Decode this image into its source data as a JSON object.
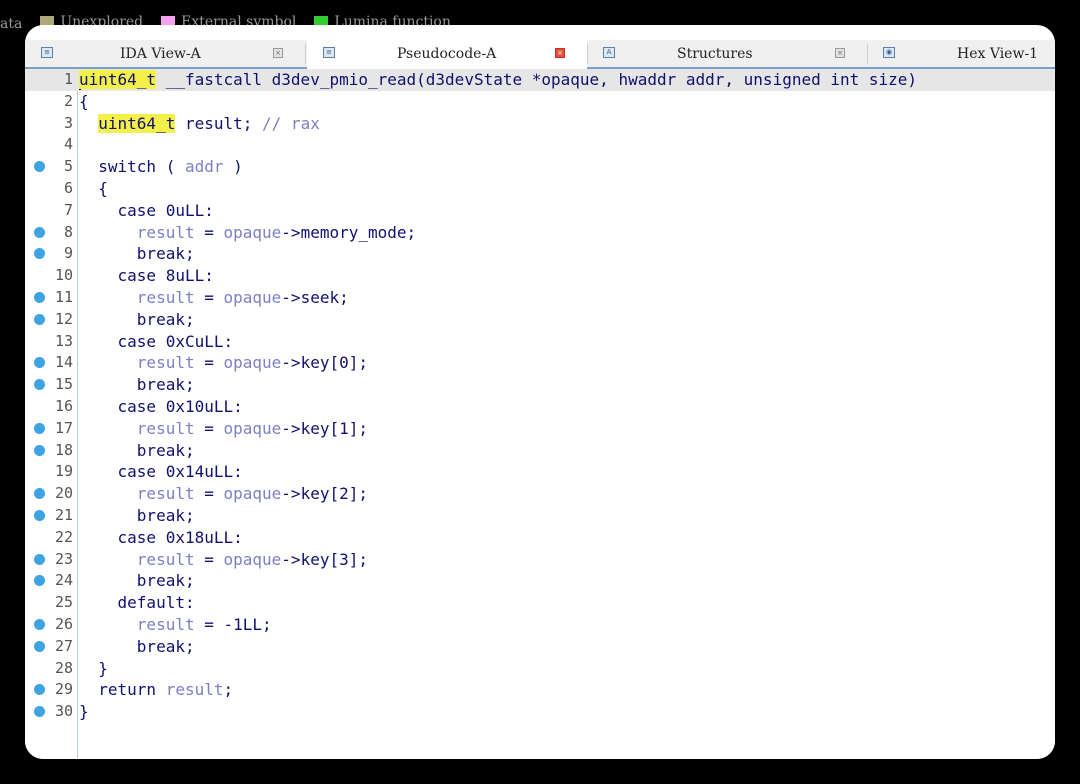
{
  "legend": [
    {
      "label": "ata",
      "color": ""
    },
    {
      "label": "Unexplored",
      "color": "#b0a878"
    },
    {
      "label": "External symbol",
      "color": "#f5a0f0"
    },
    {
      "label": "Lumina function",
      "color": "#33cc33"
    }
  ],
  "tabs": [
    {
      "label": "IDA View-A",
      "icon": "ida-view-icon",
      "active": false
    },
    {
      "label": "Pseudocode-A",
      "icon": "pseudocode-icon",
      "active": true
    },
    {
      "label": "Structures",
      "icon": "structures-icon",
      "active": false
    },
    {
      "label": "Hex View-1",
      "icon": "hex-view-icon",
      "active": false
    }
  ],
  "colors": {
    "breakpoint": "#3ea3e3",
    "highlight": "#f3f04a",
    "variable": "#7d7fc4",
    "code": "#10106e",
    "active_close": "#e74c3c"
  },
  "code_lines": [
    {
      "num": "1",
      "bp": false,
      "current": true,
      "indent": "",
      "parts": [
        [
          "uint64_t",
          "hl"
        ],
        [
          " __fastcall d3dev_pmio_read(d3devState *opaque, hwaddr addr, unsigned int size)",
          ""
        ]
      ]
    },
    {
      "num": "2",
      "bp": false,
      "indent": "",
      "parts": [
        [
          "{",
          ""
        ]
      ]
    },
    {
      "num": "3",
      "bp": false,
      "indent": "  ",
      "parts": [
        [
          "uint64_t",
          "hl"
        ],
        [
          " result; ",
          ""
        ],
        [
          "// rax",
          "var"
        ]
      ]
    },
    {
      "num": "4",
      "bp": false,
      "indent": "",
      "parts": []
    },
    {
      "num": "5",
      "bp": true,
      "indent": "  ",
      "parts": [
        [
          "switch ( ",
          ""
        ],
        [
          "addr",
          "var"
        ],
        [
          " )",
          ""
        ]
      ]
    },
    {
      "num": "6",
      "bp": false,
      "indent": "  ",
      "parts": [
        [
          "{",
          ""
        ]
      ]
    },
    {
      "num": "7",
      "bp": false,
      "indent": "    ",
      "parts": [
        [
          "case 0uLL:",
          ""
        ]
      ]
    },
    {
      "num": "8",
      "bp": true,
      "indent": "      ",
      "parts": [
        [
          "result",
          "var"
        ],
        [
          " = ",
          ""
        ],
        [
          "opaque",
          "var"
        ],
        [
          "->memory_mode;",
          ""
        ]
      ]
    },
    {
      "num": "9",
      "bp": true,
      "indent": "      ",
      "parts": [
        [
          "break;",
          ""
        ]
      ]
    },
    {
      "num": "10",
      "bp": false,
      "indent": "    ",
      "parts": [
        [
          "case 8uLL:",
          ""
        ]
      ]
    },
    {
      "num": "11",
      "bp": true,
      "indent": "      ",
      "parts": [
        [
          "result",
          "var"
        ],
        [
          " = ",
          ""
        ],
        [
          "opaque",
          "var"
        ],
        [
          "->seek;",
          ""
        ]
      ]
    },
    {
      "num": "12",
      "bp": true,
      "indent": "      ",
      "parts": [
        [
          "break;",
          ""
        ]
      ]
    },
    {
      "num": "13",
      "bp": false,
      "indent": "    ",
      "parts": [
        [
          "case 0xCuLL:",
          ""
        ]
      ]
    },
    {
      "num": "14",
      "bp": true,
      "indent": "      ",
      "parts": [
        [
          "result",
          "var"
        ],
        [
          " = ",
          ""
        ],
        [
          "opaque",
          "var"
        ],
        [
          "->key[0];",
          ""
        ]
      ]
    },
    {
      "num": "15",
      "bp": true,
      "indent": "      ",
      "parts": [
        [
          "break;",
          ""
        ]
      ]
    },
    {
      "num": "16",
      "bp": false,
      "indent": "    ",
      "parts": [
        [
          "case 0x10uLL:",
          ""
        ]
      ]
    },
    {
      "num": "17",
      "bp": true,
      "indent": "      ",
      "parts": [
        [
          "result",
          "var"
        ],
        [
          " = ",
          ""
        ],
        [
          "opaque",
          "var"
        ],
        [
          "->key[1];",
          ""
        ]
      ]
    },
    {
      "num": "18",
      "bp": true,
      "indent": "      ",
      "parts": [
        [
          "break;",
          ""
        ]
      ]
    },
    {
      "num": "19",
      "bp": false,
      "indent": "    ",
      "parts": [
        [
          "case 0x14uLL:",
          ""
        ]
      ]
    },
    {
      "num": "20",
      "bp": true,
      "indent": "      ",
      "parts": [
        [
          "result",
          "var"
        ],
        [
          " = ",
          ""
        ],
        [
          "opaque",
          "var"
        ],
        [
          "->key[2];",
          ""
        ]
      ]
    },
    {
      "num": "21",
      "bp": true,
      "indent": "      ",
      "parts": [
        [
          "break;",
          ""
        ]
      ]
    },
    {
      "num": "22",
      "bp": false,
      "indent": "    ",
      "parts": [
        [
          "case 0x18uLL:",
          ""
        ]
      ]
    },
    {
      "num": "23",
      "bp": true,
      "indent": "      ",
      "parts": [
        [
          "result",
          "var"
        ],
        [
          " = ",
          ""
        ],
        [
          "opaque",
          "var"
        ],
        [
          "->key[3];",
          ""
        ]
      ]
    },
    {
      "num": "24",
      "bp": true,
      "indent": "      ",
      "parts": [
        [
          "break;",
          ""
        ]
      ]
    },
    {
      "num": "25",
      "bp": false,
      "indent": "    ",
      "parts": [
        [
          "default:",
          ""
        ]
      ]
    },
    {
      "num": "26",
      "bp": true,
      "indent": "      ",
      "parts": [
        [
          "result",
          "var"
        ],
        [
          " = -1LL;",
          ""
        ]
      ]
    },
    {
      "num": "27",
      "bp": true,
      "indent": "      ",
      "parts": [
        [
          "break;",
          ""
        ]
      ]
    },
    {
      "num": "28",
      "bp": false,
      "indent": "  ",
      "parts": [
        [
          "}",
          ""
        ]
      ]
    },
    {
      "num": "29",
      "bp": true,
      "indent": "  ",
      "parts": [
        [
          "return ",
          ""
        ],
        [
          "result",
          "var"
        ],
        [
          ";",
          ""
        ]
      ]
    },
    {
      "num": "30",
      "bp": true,
      "indent": "",
      "parts": [
        [
          "}",
          ""
        ]
      ]
    }
  ]
}
